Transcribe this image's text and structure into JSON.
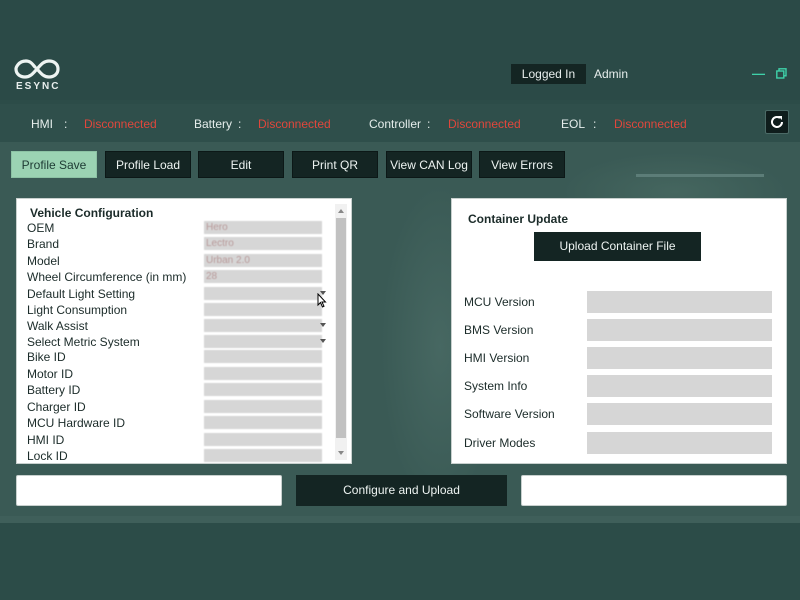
{
  "brand": {
    "logo_text": "ESYNC"
  },
  "header": {
    "logged_in_label": "Logged In",
    "user": "Admin"
  },
  "status": [
    {
      "label": "HMI",
      "value": "Disconnected"
    },
    {
      "label": "Battery",
      "value": "Disconnected"
    },
    {
      "label": "Controller",
      "value": "Disconnected"
    },
    {
      "label": "EOL",
      "value": "Disconnected"
    }
  ],
  "status_colon": ":",
  "toolbar": {
    "profile_save": "Profile Save",
    "profile_load": "Profile Load",
    "edit": "Edit",
    "print_qr": "Print QR",
    "view_can_log": "View CAN Log",
    "view_errors": "View Errors"
  },
  "vehicle_config": {
    "title": "Vehicle Configuration",
    "fields": [
      {
        "label": "OEM",
        "value": "Hero"
      },
      {
        "label": "Brand",
        "value": "Lectro"
      },
      {
        "label": "Model",
        "value": "Urban 2.0"
      },
      {
        "label": "Wheel Circumference (in mm)",
        "value": "28"
      },
      {
        "label": "Default Light Setting",
        "value": ""
      },
      {
        "label": "Light Consumption",
        "value": ""
      },
      {
        "label": "Walk Assist",
        "value": ""
      },
      {
        "label": "Select Metric System",
        "value": ""
      },
      {
        "label": "Bike ID",
        "value": ""
      },
      {
        "label": "Motor ID",
        "value": ""
      },
      {
        "label": "Battery ID",
        "value": ""
      },
      {
        "label": "Charger ID",
        "value": ""
      },
      {
        "label": "MCU Hardware ID",
        "value": ""
      },
      {
        "label": "HMI ID",
        "value": ""
      },
      {
        "label": "Lock ID",
        "value": ""
      }
    ]
  },
  "container_update": {
    "title": "Container Update",
    "upload_button": "Upload Container File",
    "fields": [
      {
        "label": "MCU Version",
        "value": ""
      },
      {
        "label": "BMS Version",
        "value": ""
      },
      {
        "label": "HMI Version",
        "value": ""
      },
      {
        "label": "System Info",
        "value": ""
      },
      {
        "label": "Software Version",
        "value": ""
      },
      {
        "label": "Driver Modes",
        "value": ""
      }
    ]
  },
  "bottom": {
    "configure_button": "Configure and Upload"
  },
  "colors": {
    "accent": "#3fd1a9",
    "error": "#e0473c",
    "dark": "#142523",
    "active": "#9bd3b3"
  }
}
